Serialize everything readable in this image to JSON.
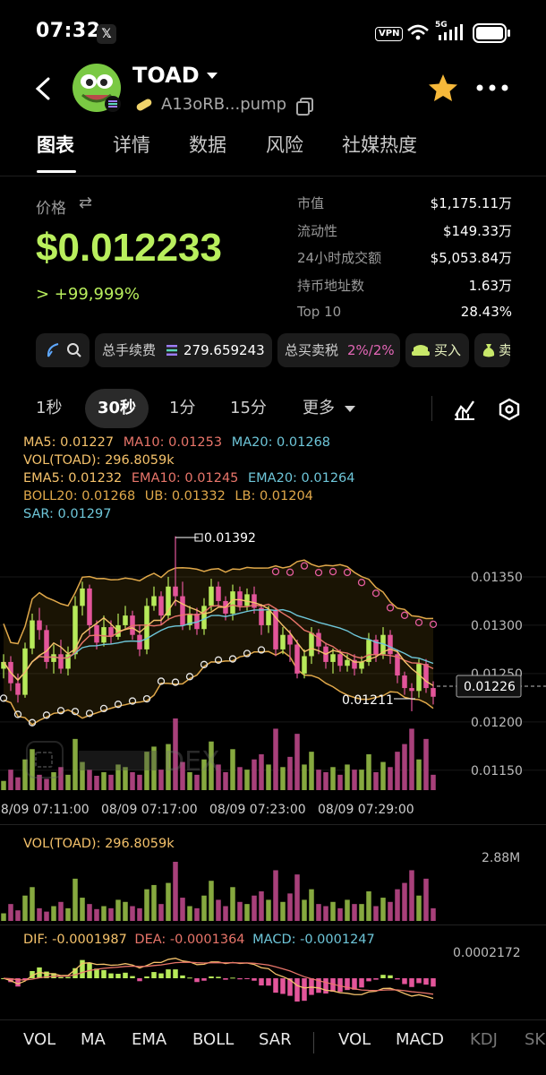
{
  "status_bar": {
    "time": "07:32",
    "x_icon": "𝕏",
    "vpn": "VPN",
    "network": "5G"
  },
  "header": {
    "token_name": "TOAD",
    "address": "A13oRB...pump"
  },
  "tabs": [
    "图表",
    "详情",
    "数据",
    "风险",
    "社媒热度"
  ],
  "price_block": {
    "label": "价格",
    "swap_symbol": "⇄",
    "price": "$0.012233",
    "change": "> +99,999%"
  },
  "stats": [
    {
      "key": "市值",
      "value": "$1,175.11万"
    },
    {
      "key": "流动性",
      "value": "$149.33万"
    },
    {
      "key": "24小时成交额",
      "value": "$5,053.84万"
    },
    {
      "key": "持币地址数",
      "value": "1.63万"
    },
    {
      "key": "Top 10",
      "value": "28.43%"
    }
  ],
  "pills": {
    "fee_label": "总手续费",
    "fee_value": "279.659243",
    "tax_label": "总买卖税",
    "tax_value": "2%/2%",
    "buy_label": "买入",
    "extra_label": "卖"
  },
  "intervals": {
    "items": [
      "1秒",
      "30秒",
      "1分",
      "15分"
    ],
    "more": "更多"
  },
  "indicators": {
    "ma5": "MA5: 0.01227",
    "ma10": "MA10: 0.01253",
    "ma20": "MA20: 0.01268",
    "vol": "VOL(TOAD): 296.8059k",
    "ema5": "EMA5: 0.01232",
    "ema10": "EMA10: 0.01245",
    "ema20": "EMA20: 0.01264",
    "boll": "BOLL20: 0.01268",
    "ub": "UB: 0.01332",
    "lb": "LB: 0.01204",
    "sar": "SAR: 0.01297"
  },
  "chart_data": {
    "type": "candlestick",
    "y_ticks": [
      "0.01350",
      "0.01300",
      "0.01250",
      "0.01200",
      "0.01150"
    ],
    "ylim": [
      0.01122,
      0.014
    ],
    "x_ticks": [
      "08/09 07:11:00",
      "08/09 07:17:00",
      "08/09 07:23:00",
      "08/09 07:29:00"
    ],
    "high_label": "0.01392",
    "low_label": "0.01211",
    "last_price": "0.01226",
    "watermark": "DEX",
    "candles": [
      [
        0.01255,
        0.01262,
        0.0127,
        0.01245
      ],
      [
        0.01262,
        0.0124,
        0.01268,
        0.01232
      ],
      [
        0.0124,
        0.01228,
        0.0125,
        0.0122
      ],
      [
        0.01228,
        0.01276,
        0.01282,
        0.01225
      ],
      [
        0.01276,
        0.01305,
        0.01312,
        0.0127
      ],
      [
        0.01305,
        0.01295,
        0.01318,
        0.01285
      ],
      [
        0.01295,
        0.01262,
        0.013,
        0.01255
      ],
      [
        0.01262,
        0.0127,
        0.0128,
        0.0125
      ],
      [
        0.0127,
        0.01255,
        0.01285,
        0.0125
      ],
      [
        0.01255,
        0.0127,
        0.01278,
        0.01248
      ],
      [
        0.0127,
        0.0132,
        0.0133,
        0.01265
      ],
      [
        0.0132,
        0.01338,
        0.01345,
        0.0131
      ],
      [
        0.01338,
        0.013,
        0.01342,
        0.0129
      ],
      [
        0.013,
        0.01282,
        0.01305,
        0.01275
      ],
      [
        0.01282,
        0.01298,
        0.0131,
        0.01278
      ],
      [
        0.01298,
        0.01288,
        0.01305,
        0.0128
      ],
      [
        0.01288,
        0.013,
        0.01312,
        0.01285
      ],
      [
        0.013,
        0.0131,
        0.0132,
        0.01295
      ],
      [
        0.0131,
        0.0129,
        0.01315,
        0.01285
      ],
      [
        0.0129,
        0.01275,
        0.013,
        0.01268
      ],
      [
        0.01275,
        0.0132,
        0.01328,
        0.0127
      ],
      [
        0.0132,
        0.0133,
        0.0134,
        0.01315
      ],
      [
        0.0133,
        0.0131,
        0.01335,
        0.013
      ],
      [
        0.0131,
        0.0134,
        0.0135,
        0.01305
      ],
      [
        0.0134,
        0.0133,
        0.01392,
        0.0132
      ],
      [
        0.0133,
        0.013,
        0.01345,
        0.01295
      ],
      [
        0.013,
        0.01312,
        0.0132,
        0.01295
      ],
      [
        0.01312,
        0.01296,
        0.01318,
        0.0129
      ],
      [
        0.01296,
        0.0132,
        0.01328,
        0.0129
      ],
      [
        0.0132,
        0.0134,
        0.01348,
        0.01315
      ],
      [
        0.0134,
        0.01325,
        0.01345,
        0.01318
      ],
      [
        0.01325,
        0.01312,
        0.0133,
        0.01305
      ],
      [
        0.01312,
        0.01335,
        0.01342,
        0.01305
      ],
      [
        0.01335,
        0.0132,
        0.0134,
        0.01315
      ],
      [
        0.0132,
        0.01332,
        0.01338,
        0.01315
      ],
      [
        0.01332,
        0.01318,
        0.0134,
        0.01312
      ],
      [
        0.01318,
        0.013,
        0.01322,
        0.0129
      ],
      [
        0.013,
        0.01315,
        0.0132,
        0.01292
      ],
      [
        0.01315,
        0.01275,
        0.01318,
        0.01268
      ],
      [
        0.01275,
        0.0129,
        0.01298,
        0.0127
      ],
      [
        0.0129,
        0.0128,
        0.01295,
        0.01262
      ],
      [
        0.0128,
        0.0125,
        0.01285,
        0.01245
      ],
      [
        0.0125,
        0.01268,
        0.01275,
        0.01245
      ],
      [
        0.01268,
        0.01292,
        0.01298,
        0.0126
      ],
      [
        0.01292,
        0.01278,
        0.01296,
        0.0127
      ],
      [
        0.01278,
        0.01262,
        0.01282,
        0.01255
      ],
      [
        0.01262,
        0.0127,
        0.01276,
        0.0125
      ],
      [
        0.0127,
        0.01258,
        0.01275,
        0.01252
      ],
      [
        0.01258,
        0.01264,
        0.0127,
        0.01252
      ],
      [
        0.01264,
        0.01255,
        0.0127,
        0.01248
      ],
      [
        0.01255,
        0.01262,
        0.01268,
        0.0125
      ],
      [
        0.01262,
        0.01285,
        0.01292,
        0.01258
      ],
      [
        0.01285,
        0.0127,
        0.0129,
        0.01262
      ],
      [
        0.0127,
        0.0129,
        0.01298,
        0.01265
      ],
      [
        0.0129,
        0.0127,
        0.01295,
        0.0126
      ],
      [
        0.0127,
        0.01248,
        0.01275,
        0.0124
      ],
      [
        0.01248,
        0.01235,
        0.01252,
        0.01228
      ],
      [
        0.01235,
        0.01232,
        0.0124,
        0.01211
      ],
      [
        0.01232,
        0.0126,
        0.01265,
        0.01225
      ],
      [
        0.0126,
        0.01235,
        0.01265,
        0.0123
      ],
      [
        0.01235,
        0.01226,
        0.01242,
        0.01218
      ]
    ],
    "volumes": [
      18,
      40,
      25,
      60,
      80,
      30,
      22,
      35,
      45,
      30,
      100,
      55,
      40,
      28,
      35,
      30,
      50,
      45,
      35,
      30,
      75,
      85,
      40,
      90,
      140,
      55,
      35,
      30,
      60,
      95,
      50,
      35,
      80,
      45,
      40,
      60,
      70,
      50,
      120,
      45,
      65,
      110,
      50,
      75,
      40,
      35,
      45,
      30,
      50,
      40,
      40,
      70,
      35,
      55,
      45,
      75,
      90,
      120,
      60,
      100,
      30
    ],
    "vol_panel": {
      "label": "VOL(TOAD): 296.8059k",
      "max_tick": "2.88M"
    },
    "macd_panel": {
      "dif": "DIF: -0.0001987",
      "dea": "DEA: -0.0001364",
      "macd": "MACD: -0.0001247",
      "max_tick": "0.0002172"
    },
    "colors": {
      "up": "#b7ea5a",
      "down": "#e3559a",
      "ma5": "#f5c26b",
      "ma10": "#e8756a",
      "ma20": "#6ec6d9",
      "band": "#e0a84a",
      "sar": "#e65d9f"
    }
  },
  "bottom_tabs": [
    "VOL",
    "MA",
    "EMA",
    "BOLL",
    "SAR",
    "VOL",
    "MACD",
    "KDJ",
    "SK"
  ]
}
